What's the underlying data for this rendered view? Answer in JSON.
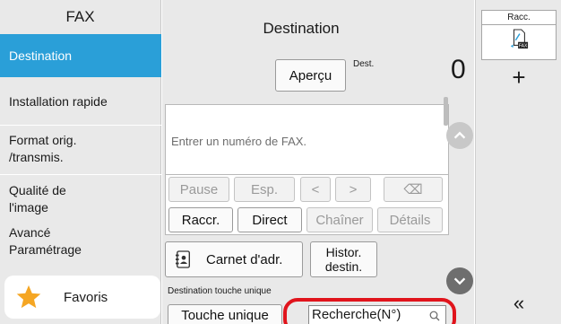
{
  "sidebar": {
    "title": "FAX",
    "items": [
      {
        "label": "Destination",
        "active": true
      },
      {
        "label": "Installation rapide",
        "active": false
      },
      {
        "label": "Format orig. /transmis.",
        "active": false
      },
      {
        "label": "Qualité de l'image",
        "active": false
      },
      {
        "label": "Avancé Paramétrage",
        "active": false
      }
    ],
    "favorites_label": "Favoris"
  },
  "main": {
    "title": "Destination",
    "preview_label": "Aperçu",
    "dest_label": "Dest.",
    "dest_count": "0",
    "fax_placeholder": "Entrer un numéro de FAX.",
    "keys_row1": [
      "Pause",
      "Esp.",
      "<",
      ">",
      "⌫"
    ],
    "keys_row2": [
      "Raccr.",
      "Direct",
      "Chaîner",
      "Détails"
    ],
    "address_book_label": "Carnet d'adr.",
    "history_label": "Histor. destin.",
    "one_touch_caption": "Destination touche unique",
    "one_touch_button": "Touche unique",
    "search_value": "Recherche(N°)"
  },
  "right": {
    "shortcut_title": "Racc.",
    "shortcut_icon": "fax-document-icon",
    "add_label": "+",
    "collapse_label": "«"
  },
  "colors": {
    "accent": "#2a9fd8",
    "highlight_ring": "#e0141c",
    "star": "#f5a623"
  }
}
